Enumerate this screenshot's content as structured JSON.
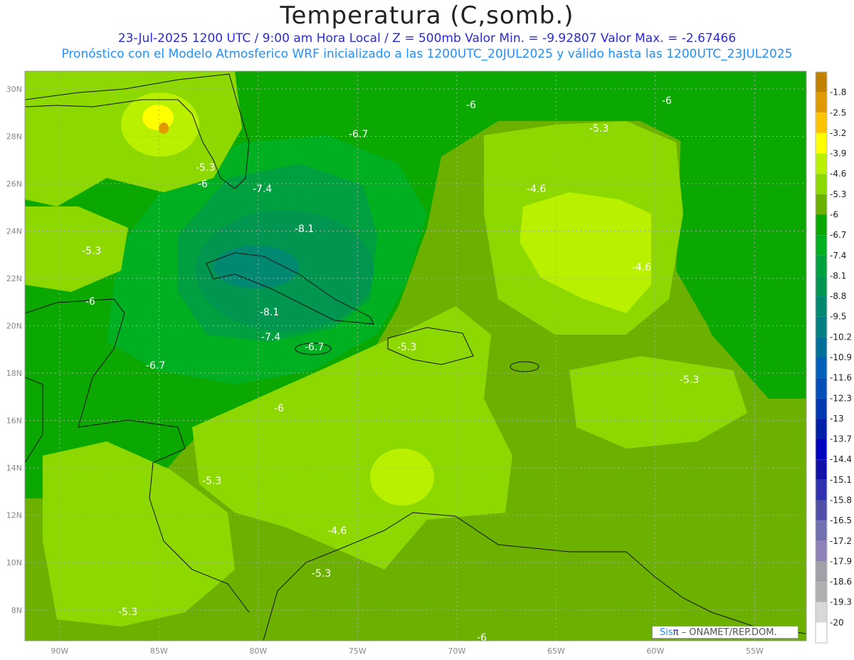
{
  "header": {
    "title": "Temperatura (C,somb.)",
    "line1": "23-Jul-2025   1200 UTC / 9:00 am Hora Local / Z = 500mb  Valor Min. = -9.92807  Valor Max. = -2.67466",
    "line2": "Pronóstico con el Modelo Atmosferico WRF inicializado a las 1200UTC_20JUL2025 y válido hasta las  1200UTC_23JUL2025"
  },
  "axes": {
    "lat_labels": [
      "30N",
      "28N",
      "26N",
      "24N",
      "22N",
      "20N",
      "18N",
      "16N",
      "14N",
      "12N",
      "10N",
      "8N"
    ],
    "lat_values": [
      30,
      28,
      26,
      24,
      22,
      20,
      18,
      16,
      14,
      12,
      10,
      8
    ],
    "lon_labels": [
      "90W",
      "85W",
      "80W",
      "75W",
      "70W",
      "65W",
      "60W",
      "55W"
    ],
    "lon_values": [
      -90,
      -85,
      -80,
      -75,
      -70,
      -65,
      -60,
      -55
    ],
    "lon_range": [
      -91.75,
      -52.4
    ],
    "lat_range": [
      6.7,
      30.75
    ]
  },
  "colorbar": {
    "labels": [
      "-1.8",
      "-2.5",
      "-3.2",
      "-3.9",
      "-4.6",
      "-5.3",
      "-6",
      "-6.7",
      "-7.4",
      "-8.1",
      "-8.8",
      "-9.5",
      "-10.2",
      "-10.9",
      "-11.6",
      "-12.3",
      "-13",
      "-13.7",
      "-14.4",
      "-15.1",
      "-15.8",
      "-16.5",
      "-17.2",
      "-17.9",
      "-18.6",
      "-19.3",
      "-20"
    ],
    "colors": [
      "#c08000",
      "#e09a00",
      "#ffc400",
      "#ffff00",
      "#b8f000",
      "#8cd800",
      "#6cb000",
      "#0aa800",
      "#00b020",
      "#00a040",
      "#009650",
      "#008870",
      "#008080",
      "#007098",
      "#0060b8",
      "#0050b8",
      "#0038b0",
      "#0020a8",
      "#0000c0",
      "#1010a8",
      "#3030b0",
      "#5050a8",
      "#7070b0",
      "#9080b8",
      "#a0a0a8",
      "#b0b0b0",
      "#d8d8d8",
      "#ffffff"
    ]
  },
  "contour_labels": [
    "-6",
    "-6",
    "-5.3",
    "-6.7",
    "-5.3",
    "-6",
    "-7.4",
    "-4.6",
    "-8.1",
    "-5.3",
    "-4.6",
    "-8.1",
    "-6",
    "-7.4",
    "-6.7",
    "-5.3",
    "-6.7",
    "-5.3",
    "-6",
    "-5.3",
    "-4.6",
    "-5.3",
    "-5.3",
    "-6"
  ],
  "credit": {
    "logo_a": "Sis",
    "logo_b": "π",
    "text": " – ONAMET/REP.DOM."
  }
}
